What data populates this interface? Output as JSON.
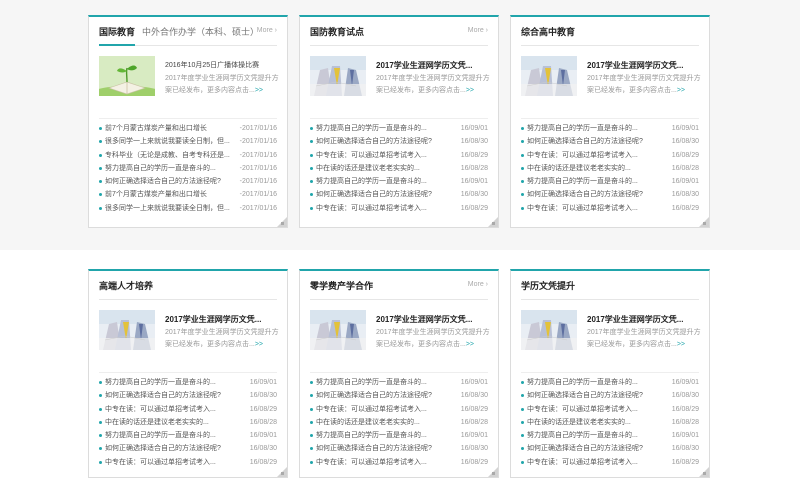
{
  "cards": [
    {
      "tabs": [
        "国际教育",
        "中外合作办学（本科、硕士）"
      ],
      "more": "More",
      "feature": {
        "date": "2016年10月25日广播体操比赛",
        "desc": "2017年度学业生涯网学历文凭提升方案已经发布，更多内容点击...",
        "more": ">>"
      },
      "items": [
        {
          "text": "前7个月蒙古煤炭产量和出口增长",
          "date": "-2017/01/16"
        },
        {
          "text": "很多同学一上来就说我要读全日制，但...",
          "date": "-2017/01/16"
        },
        {
          "text": "专科毕业（无论是成教、自考专科还是...",
          "date": "-2017/01/16"
        },
        {
          "text": "努力提高自己的学历一直是奋斗的...",
          "date": "-2017/01/16"
        },
        {
          "text": "如何正确选择适合自己的方法途径呢?",
          "date": "-2017/01/16"
        },
        {
          "text": "前7个月蒙古煤炭产量和出口增长",
          "date": "-2017/01/16"
        },
        {
          "text": "很多同学一上来就说我要读全日制，但...",
          "date": "-2017/01/16"
        }
      ]
    },
    {
      "title": "国防教育试点",
      "more": "More",
      "feature": {
        "title": "2017学业生涯网学历文凭...",
        "desc": "2017年度学业生涯网学历文凭提升方案已经发布，更多内容点击...",
        "more": ">>"
      },
      "items": [
        {
          "text": "努力提高自己的学历一直是奋斗的...",
          "date": "16/09/01"
        },
        {
          "text": "如何正确选择适合自己的方法途径呢?",
          "date": "16/08/30"
        },
        {
          "text": "中专在读：可以通过单招考试考入...",
          "date": "16/08/29"
        },
        {
          "text": "中在读的话还是建议老老实实的...",
          "date": "16/08/28"
        },
        {
          "text": "努力提高自己的学历一直是奋斗的...",
          "date": "16/09/01"
        },
        {
          "text": "如何正确选择适合自己的方法途径呢?",
          "date": "16/08/30"
        },
        {
          "text": "中专在读：可以通过单招考试考入...",
          "date": "16/08/29"
        }
      ]
    },
    {
      "title": "综合高中教育",
      "feature": {
        "title": "2017学业生涯网学历文凭...",
        "desc": "2017年度学业生涯网学历文凭提升方案已经发布，更多内容点击...",
        "more": ">>"
      },
      "items": [
        {
          "text": "努力提高自己的学历一直是奋斗的...",
          "date": "16/09/01"
        },
        {
          "text": "如何正确选择适合自己的方法途径呢?",
          "date": "16/08/30"
        },
        {
          "text": "中专在读：可以通过单招考试考入...",
          "date": "16/08/29"
        },
        {
          "text": "中在读的话还是建议老老实实的...",
          "date": "16/08/28"
        },
        {
          "text": "努力提高自己的学历一直是奋斗的...",
          "date": "16/09/01"
        },
        {
          "text": "如何正确选择适合自己的方法途径呢?",
          "date": "16/08/30"
        },
        {
          "text": "中专在读：可以通过单招考试考入...",
          "date": "16/08/29"
        }
      ]
    },
    {
      "title": "高端人才培养",
      "feature": {
        "title": "2017学业生涯网学历文凭...",
        "desc": "2017年度学业生涯网学历文凭提升方案已经发布，更多内容点击...",
        "more": ">>"
      },
      "items": [
        {
          "text": "努力提高自己的学历一直是奋斗的...",
          "date": "16/09/01"
        },
        {
          "text": "如何正确选择适合自己的方法途径呢?",
          "date": "16/08/30"
        },
        {
          "text": "中专在读：可以通过单招考试考入...",
          "date": "16/08/29"
        },
        {
          "text": "中在读的话还是建议老老实实的...",
          "date": "16/08/28"
        },
        {
          "text": "努力提高自己的学历一直是奋斗的...",
          "date": "16/09/01"
        },
        {
          "text": "如何正确选择适合自己的方法途径呢?",
          "date": "16/08/30"
        },
        {
          "text": "中专在读：可以通过单招考试考入...",
          "date": "16/08/29"
        }
      ]
    },
    {
      "title": "零学费产学合作",
      "more": "More",
      "feature": {
        "title": "2017学业生涯网学历文凭...",
        "desc": "2017年度学业生涯网学历文凭提升方案已经发布，更多内容点击...",
        "more": ">>"
      },
      "items": [
        {
          "text": "努力提高自己的学历一直是奋斗的...",
          "date": "16/09/01"
        },
        {
          "text": "如何正确选择适合自己的方法途径呢?",
          "date": "16/08/30"
        },
        {
          "text": "中专在读：可以通过单招考试考入...",
          "date": "16/08/29"
        },
        {
          "text": "中在读的话还是建议老老实实的...",
          "date": "16/08/28"
        },
        {
          "text": "努力提高自己的学历一直是奋斗的...",
          "date": "16/09/01"
        },
        {
          "text": "如何正确选择适合自己的方法途径呢?",
          "date": "16/08/30"
        },
        {
          "text": "中专在读：可以通过单招考试考入...",
          "date": "16/08/29"
        }
      ]
    },
    {
      "title": "学历文凭提升",
      "feature": {
        "title": "2017学业生涯网学历文凭...",
        "desc": "2017年度学业生涯网学历文凭提升方案已经发布，更多内容点击...",
        "more": ">>"
      },
      "items": [
        {
          "text": "努力提高自己的学历一直是奋斗的...",
          "date": "16/09/01"
        },
        {
          "text": "如何正确选择适合自己的方法途径呢?",
          "date": "16/08/30"
        },
        {
          "text": "中专在读：可以通过单招考试考入...",
          "date": "16/08/29"
        },
        {
          "text": "中在读的话还是建议老老实实的...",
          "date": "16/08/28"
        },
        {
          "text": "努力提高自己的学历一直是奋斗的...",
          "date": "16/09/01"
        },
        {
          "text": "如何正确选择适合自己的方法途径呢?",
          "date": "16/08/30"
        },
        {
          "text": "中专在读：可以通过单招考试考入...",
          "date": "16/08/29"
        }
      ]
    }
  ],
  "colors": {
    "accent": "#21a5ab"
  }
}
